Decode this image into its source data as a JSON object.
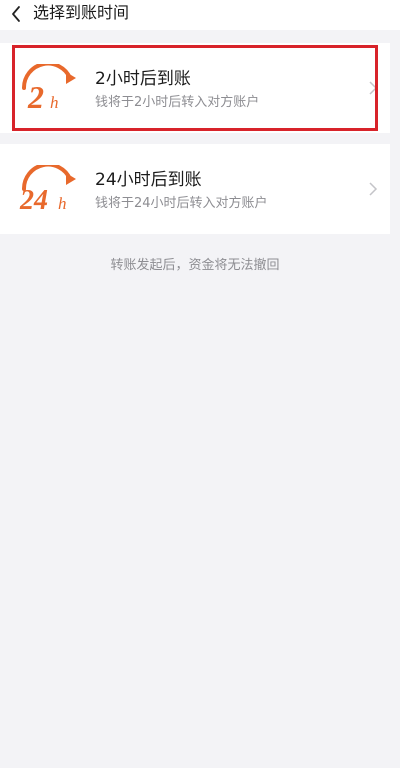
{
  "header": {
    "title": "选择到账时间",
    "back_icon": "chevron-left-icon"
  },
  "options": [
    {
      "badge_number": "2",
      "badge_unit": "h",
      "title": "2小时后到账",
      "description": "钱将于2小时后转入对方账户",
      "selected": true
    },
    {
      "badge_number": "24",
      "badge_unit": "h",
      "title": "24小时后到账",
      "description": "钱将于24小时后转入对方账户",
      "selected": false
    }
  ],
  "footer": {
    "note": "转账发起后，资金将无法撤回"
  },
  "colors": {
    "badge_orange": "#e8692c",
    "highlight_red": "#d8232a",
    "background": "#f3f3f6"
  }
}
